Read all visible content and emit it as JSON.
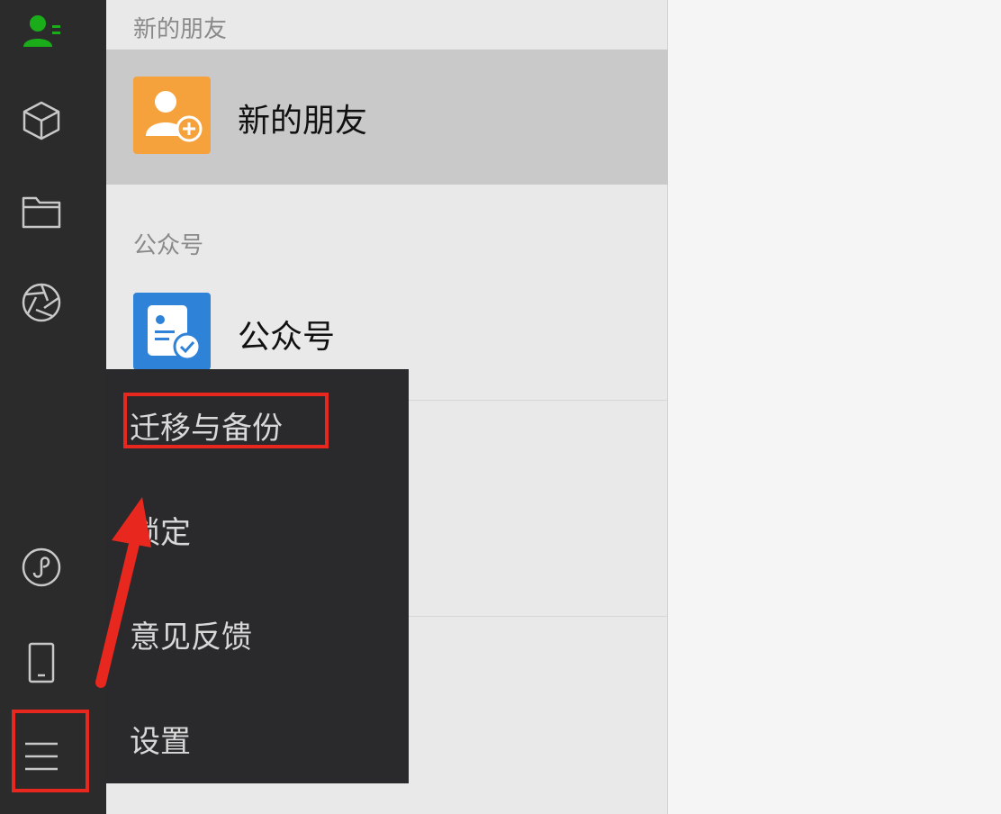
{
  "sidebar": {
    "items": [
      {
        "icon": "contacts-icon",
        "active": true
      },
      {
        "icon": "cube-icon"
      },
      {
        "icon": "folder-icon"
      },
      {
        "icon": "moments-aperture-icon"
      },
      {
        "icon": "mini-program-icon"
      },
      {
        "icon": "phone-icon"
      },
      {
        "icon": "menu-hamburger-icon"
      }
    ],
    "active_color": "#1aad19"
  },
  "contacts": {
    "sections": [
      {
        "header": "新的朋友",
        "item_label": "新的朋友",
        "avatar_color": "#f5a23c",
        "selected": true
      },
      {
        "header": "公众号",
        "item_label": "公众号",
        "avatar_color": "#2e82d8",
        "selected": false
      }
    ]
  },
  "menu": {
    "items": [
      "迁移与备份",
      "锁定",
      "意见反馈",
      "设置"
    ]
  },
  "annotation": {
    "highlight_color": "#e8281e"
  }
}
